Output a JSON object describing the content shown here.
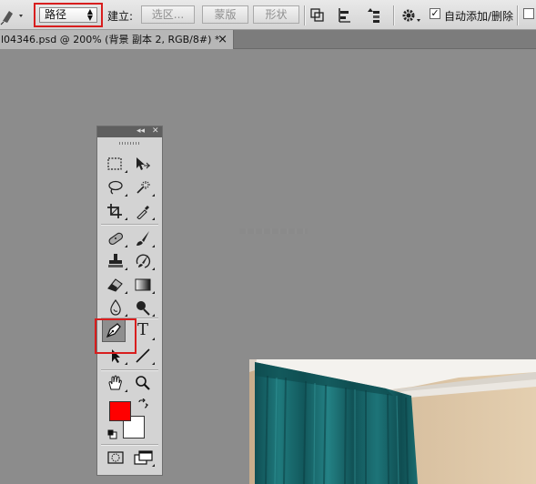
{
  "options_bar": {
    "mode_value": "路径",
    "build_label": "建立:",
    "selection_button": "选区...",
    "mask_button": "蒙版",
    "shape_button": "形状",
    "auto_add_delete_label": "自动添加/删除",
    "auto_add_delete_checked": true
  },
  "document_tab": {
    "title": "l04346.psd @ 200% (背景 副本 2, RGB/8#) *",
    "close_label": "×"
  },
  "toolbox": {
    "collapse_label": "◂◂",
    "close_label": "✕",
    "type_tool_glyph": "T",
    "foreground_color": "#ff0000",
    "background_color": "#ffffff"
  },
  "highlight_color": "#d81e1e"
}
